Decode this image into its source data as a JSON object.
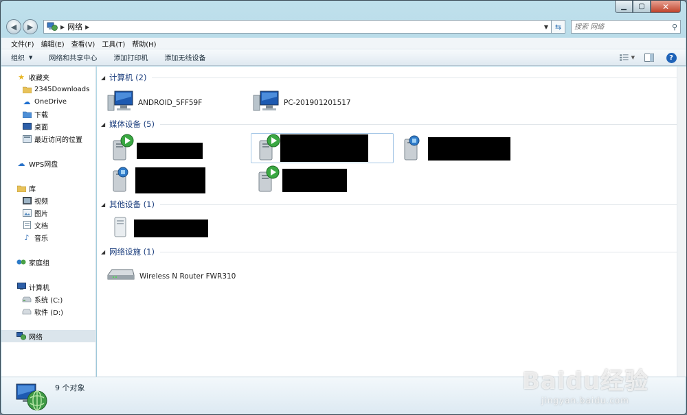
{
  "address": {
    "crumbs": [
      "网络"
    ],
    "search_placeholder": "搜索 网络"
  },
  "menu": [
    "文件(F)",
    "编辑(E)",
    "查看(V)",
    "工具(T)",
    "帮助(H)"
  ],
  "commands": {
    "organize": "组织",
    "network_center": "网络和共享中心",
    "add_printer": "添加打印机",
    "add_wireless": "添加无线设备"
  },
  "nav": {
    "favorites": "收藏夹",
    "downloads2345": "2345Downloads",
    "onedrive": "OneDrive",
    "downloads": "下载",
    "desktop": "桌面",
    "recent": "最近访问的位置",
    "wps": "WPS网盘",
    "libraries": "库",
    "videos": "视频",
    "pictures": "图片",
    "documents": "文档",
    "music": "音乐",
    "homegroup": "家庭组",
    "computer": "计算机",
    "drive_c": "系统 (C:)",
    "drive_d": "软件 (D:)",
    "network": "网络"
  },
  "groups": {
    "computers": "计算机 (2)",
    "media": "媒体设备 (5)",
    "other": "其他设备 (1)",
    "infrastructure": "网络设施 (1)"
  },
  "computers": [
    "ANDROID_5FF59F",
    "PC-201901201517"
  ],
  "infrastructure_items": [
    "Wireless N Router FWR310"
  ],
  "status": {
    "count": "9 个对象"
  },
  "watermark": {
    "main": "Baidu经验",
    "sub": "jingyan.baidu.com"
  }
}
